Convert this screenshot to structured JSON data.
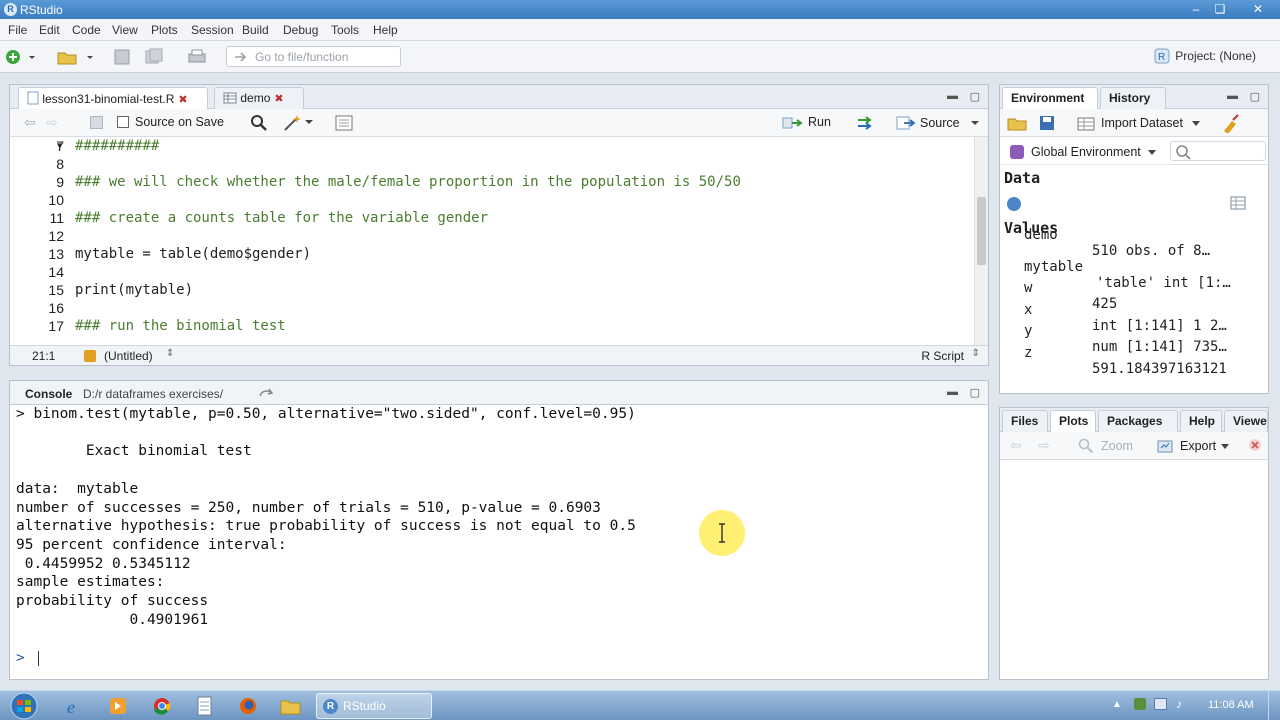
{
  "window": {
    "title": "RStudio"
  },
  "menu": [
    "File",
    "Edit",
    "Code",
    "View",
    "Plots",
    "Session",
    "Build",
    "Debug",
    "Tools",
    "Help"
  ],
  "toolbar": {
    "goto_placeholder": "Go to file/function",
    "project": "Project: (None)"
  },
  "editor": {
    "tabs": [
      {
        "label": "lesson31-binomial-test.R"
      },
      {
        "label": "demo"
      }
    ],
    "source_on_save": "Source on Save",
    "run_label": "Run",
    "source_label": "Source",
    "lines": [
      {
        "num": "7",
        "text": "##########",
        "kind": "cmt"
      },
      {
        "num": "8",
        "text": "",
        "kind": "plain"
      },
      {
        "num": "9",
        "text": "### we will check whether the male/female proportion in the population is 50/50",
        "kind": "cmt"
      },
      {
        "num": "10",
        "text": "",
        "kind": "plain"
      },
      {
        "num": "11",
        "text": "### create a counts table for the variable gender",
        "kind": "cmt"
      },
      {
        "num": "12",
        "text": "",
        "kind": "plain"
      },
      {
        "num": "13",
        "text": "mytable = table(demo$gender)",
        "kind": "plain"
      },
      {
        "num": "14",
        "text": "",
        "kind": "plain"
      },
      {
        "num": "15",
        "text": "print(mytable)",
        "kind": "plain"
      },
      {
        "num": "16",
        "text": "",
        "kind": "plain"
      },
      {
        "num": "17",
        "text": "### run the binomial test",
        "kind": "cmt"
      }
    ],
    "status_pos": "21:1",
    "status_scope": "(Untitled)",
    "status_type": "R Script"
  },
  "console": {
    "title": "Console",
    "path": "D:/r dataframes exercises/",
    "lines": [
      "> binom.test(mytable, p=0.50, alternative=\"two.sided\", conf.level=0.95)",
      "",
      "        Exact binomial test",
      "",
      "data:  mytable",
      "number of successes = 250, number of trials = 510, p-value = 0.6903",
      "alternative hypothesis: true probability of success is not equal to 0.5",
      "95 percent confidence interval:",
      " 0.4459952 0.5345112",
      "sample estimates:",
      "probability of success",
      "             0.4901961",
      "",
      "> "
    ]
  },
  "environment": {
    "tabs": [
      "Environment",
      "History"
    ],
    "import_label": "Import Dataset",
    "scope": "Global Environment",
    "data_header": "Data",
    "values_header": "Values",
    "data_rows": [
      {
        "name": "demo",
        "value": "510 obs. of 8…"
      }
    ],
    "value_rows": [
      {
        "name": "mytable",
        "value": "'table' int [1:…"
      },
      {
        "name": "w",
        "value": "425"
      },
      {
        "name": "x",
        "value": "int [1:141] 1 2…"
      },
      {
        "name": "y",
        "value": "num [1:141] 735…"
      },
      {
        "name": "z",
        "value": "591.184397163121"
      }
    ]
  },
  "files": {
    "tabs": [
      "Files",
      "Plots",
      "Packages",
      "Help",
      "Viewer"
    ],
    "zoom": "Zoom",
    "export": "Export"
  },
  "taskbar": {
    "app": "RStudio",
    "time": "11:08 AM"
  }
}
